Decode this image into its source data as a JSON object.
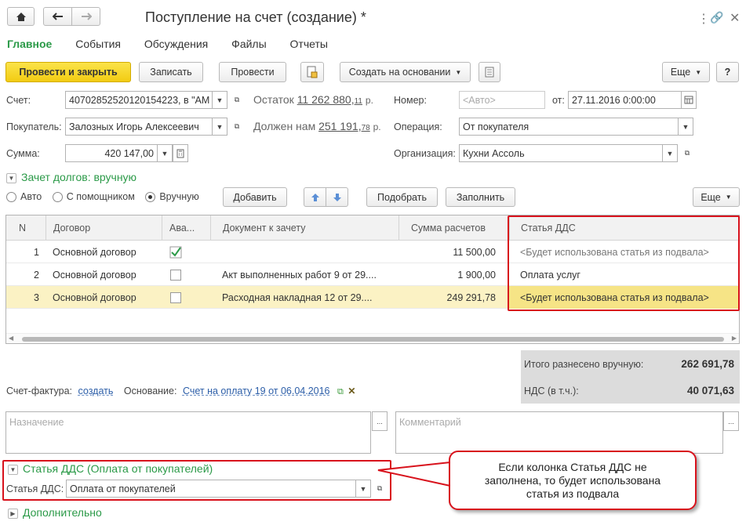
{
  "window": {
    "title": "Поступление на счет (создание) *"
  },
  "tabs": [
    "Главное",
    "События",
    "Обсуждения",
    "Файлы",
    "Отчеты"
  ],
  "toolbar": {
    "post_close": "Провести и закрыть",
    "save": "Записать",
    "post": "Провести",
    "create_based": "Создать на основании",
    "more": "Еще"
  },
  "form": {
    "account_label": "Счет:",
    "account_value": "40702852520120154223, в \"АМ",
    "balance_label": "Остаток",
    "balance_int": "11 262 880,",
    "balance_frac": "11",
    "balance_cur": "р.",
    "number_label": "Номер:",
    "number_placeholder": "<Авто>",
    "date_label": "от:",
    "date_value": "27.11.2016  0:00:00",
    "buyer_label": "Покупатель:",
    "buyer_value": "Залозных Игорь Алексеевич",
    "debt_label": "Должен нам",
    "debt_int": "251 191,",
    "debt_frac": "78",
    "debt_cur": "р.",
    "operation_label": "Операция:",
    "operation_value": "От покупателя",
    "sum_label": "Сумма:",
    "sum_value": "420 147,00",
    "org_label": "Организация:",
    "org_value": "Кухни Ассоль"
  },
  "offset": {
    "title": "Зачет долгов: вручную",
    "modes": [
      "Авто",
      "С помощником",
      "Вручную"
    ],
    "add": "Добавить",
    "pick": "Подобрать",
    "fill": "Заполнить",
    "more": "Еще"
  },
  "table": {
    "headers": [
      "N",
      "Договор",
      "Ава...",
      "Документ к зачету",
      "Сумма расчетов",
      "Статья ДДС"
    ],
    "rows": [
      {
        "n": "1",
        "contract": "Основной договор",
        "advance": true,
        "doc": "",
        "amount": "11 500,00",
        "dds": "<Будет использована статья из подвала>"
      },
      {
        "n": "2",
        "contract": "Основной договор",
        "advance": false,
        "doc": "Акт выполненных работ 9 от 29....",
        "amount": "1 900,00",
        "dds": "Оплата услуг"
      },
      {
        "n": "3",
        "contract": "Основной договор",
        "advance": false,
        "doc": "Расходная накладная 12 от 29....",
        "amount": "249 291,78",
        "dds": "<Будет использована статья из подвала>"
      }
    ]
  },
  "totals": {
    "manual_label": "Итого разнесено вручную:",
    "manual_value": "262 691,78",
    "vat_label": "НДС (в т.ч.):",
    "vat_value": "40 071,63"
  },
  "invoice": {
    "label": "Счет-фактура:",
    "link": "создать",
    "basis_label": "Основание:",
    "basis_link": "Счет на оплату 19 от 06.04.2016"
  },
  "purpose_placeholder": "Назначение",
  "comment_placeholder": "Комментарий",
  "dds_section": {
    "title": "Статья ДДС (Оплата от покупателей)",
    "label": "Статья ДДС:",
    "value": "Оплата от покупателей"
  },
  "additional": "Дополнительно",
  "callout": "Если колонка Статья ДДС не заполнена, то будет использована статья из подвала"
}
